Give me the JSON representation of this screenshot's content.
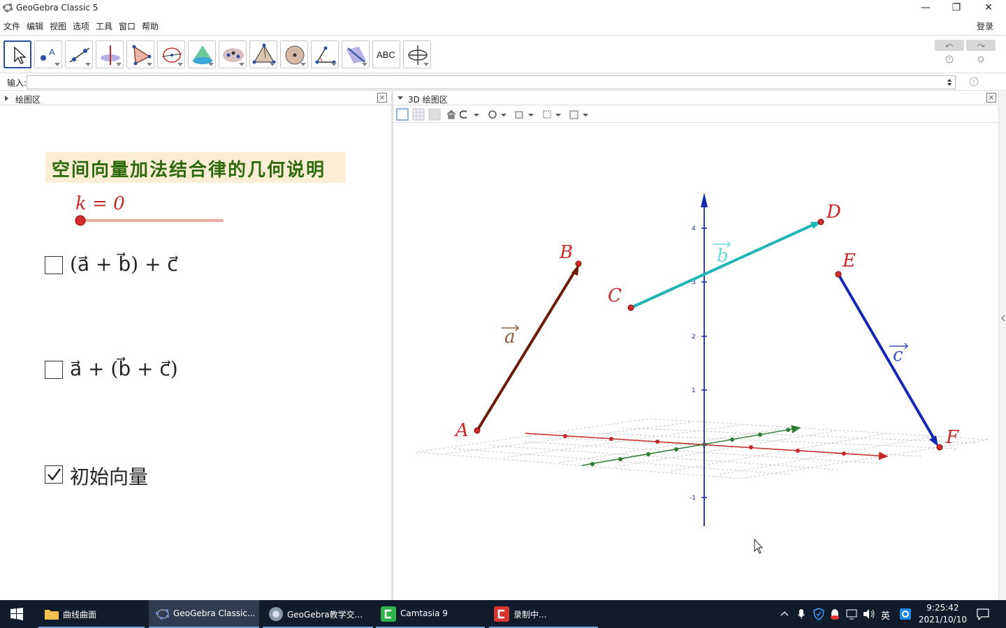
{
  "window": {
    "title": "GeoGebra Classic 5",
    "minimize": "—",
    "restore": "❐",
    "close": "✕"
  },
  "menu": {
    "items": [
      "文件",
      "编辑",
      "视图",
      "选项",
      "工具",
      "窗口",
      "帮助"
    ],
    "login": "登录"
  },
  "toolbar": {
    "tools": [
      "move-tool",
      "point-tool",
      "line-tool",
      "perpendicular-tool",
      "polygon-tool",
      "circle-tool",
      "cone-tool",
      "conic-tool",
      "pyramid-tool",
      "sphere-tool",
      "angle-tool",
      "plane-tool",
      "text-tool",
      "rotate-view-tool"
    ],
    "text_tool_label": "ABC"
  },
  "input": {
    "label": "输入:",
    "value": ""
  },
  "graphics": {
    "title": "绘图区",
    "heading": "空间向量加法结合律的几何说明",
    "slider": {
      "label": "k = 0",
      "value": 0
    },
    "checkboxes": [
      {
        "label": "(a⃗ + b⃗) + c⃗",
        "checked": false
      },
      {
        "label": "a⃗ + (b⃗ + c⃗)",
        "checked": false
      },
      {
        "label": "初始向量",
        "checked": true
      }
    ]
  },
  "graphics3d": {
    "title": "3D 绘图区",
    "points": [
      "A",
      "B",
      "C",
      "D",
      "E",
      "F"
    ],
    "vectors": [
      "a",
      "b",
      "c"
    ],
    "zticks": [
      "4",
      "3",
      "2",
      "1",
      "-1"
    ],
    "colors": {
      "a": "#6b1d0a",
      "b": "#1fb5b8",
      "c": "#1428b0",
      "xaxis": "#c62828",
      "yaxis": "#2e7d32",
      "zaxis": "#1428b0"
    }
  },
  "taskbar": {
    "items": [
      "曲线曲面",
      "GeoGebra Classic...",
      "GeoGebra教学交...",
      "Camtasia 9",
      "录制中..."
    ],
    "lang": "英",
    "time": "9:25:42",
    "date": "2021/10/10"
  }
}
